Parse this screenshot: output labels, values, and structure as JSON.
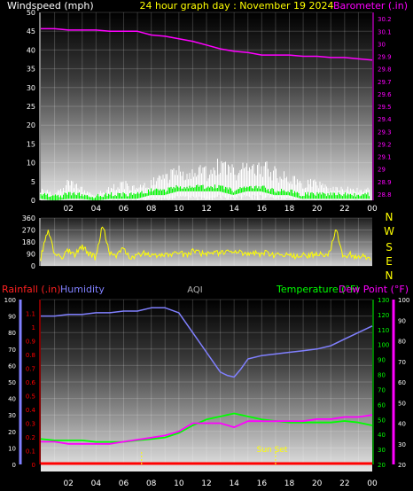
{
  "header": {
    "wind_label": "Windspeed (mph)",
    "graph_title": "24 hour graph day : November 19 2024",
    "baro_label": "Barometer (.in)"
  },
  "bottom_header": {
    "rain_label": "Rainfall (.in)",
    "humidity_label": "Humidity",
    "aqi_label": "AQI",
    "temp_label": "Temperature (°F)",
    "dew_label": "Dew Point (°F)"
  },
  "compass": [
    "N",
    "W",
    "S",
    "E",
    "N"
  ],
  "annotations": {
    "sunset": "Sun Set"
  },
  "colors": {
    "barometer": "#ff00ff",
    "wind": "#ffffff",
    "gust": "#00ff00",
    "direction": "#ffff00",
    "humidity": "#8080ff",
    "temperature": "#00ff00",
    "dewpoint": "#ff00ff",
    "rain": "#ff0000"
  },
  "chart_data": [
    {
      "type": "line",
      "title": "24 hour graph day : November 19 2024",
      "xlabel": "",
      "x_ticks": [
        "02",
        "04",
        "06",
        "08",
        "10",
        "12",
        "14",
        "16",
        "18",
        "20",
        "22",
        "00"
      ],
      "x_range": [
        0,
        24
      ],
      "y_left": {
        "label": "Windspeed (mph)",
        "range": [
          0,
          50
        ],
        "ticks": [
          0,
          5,
          10,
          15,
          20,
          25,
          30,
          35,
          40,
          45,
          50
        ]
      },
      "y_right": {
        "label": "Barometer (.in)",
        "range": [
          28.8,
          30.3
        ],
        "ticks": [
          28.8,
          28.9,
          29,
          29.1,
          29.2,
          29.3,
          29.4,
          29.5,
          29.6,
          29.7,
          29.8,
          29.9,
          30,
          30.1,
          30.2
        ]
      },
      "series": [
        {
          "name": "Barometer (.in)",
          "axis": "right",
          "x": [
            0,
            1,
            2,
            3,
            4,
            5,
            6,
            7,
            8,
            9,
            10,
            11,
            12,
            13,
            14,
            15,
            16,
            17,
            18,
            19,
            20,
            21,
            22,
            23,
            24
          ],
          "values": [
            30.12,
            30.12,
            30.11,
            30.11,
            30.11,
            30.1,
            30.1,
            30.1,
            30.07,
            30.06,
            30.04,
            30.02,
            29.99,
            29.96,
            29.94,
            29.93,
            29.91,
            29.91,
            29.91,
            29.9,
            29.9,
            29.89,
            29.89,
            29.88,
            29.87
          ]
        },
        {
          "name": "Windspeed (mph)",
          "axis": "left",
          "x": [
            0,
            1,
            2,
            3,
            4,
            5,
            6,
            7,
            8,
            9,
            10,
            11,
            12,
            13,
            14,
            15,
            16,
            17,
            18,
            19,
            20,
            21,
            22,
            23,
            24
          ],
          "values": [
            2,
            1,
            3,
            2,
            1,
            2,
            3,
            2,
            3,
            4,
            5,
            5,
            5,
            6,
            5,
            6,
            6,
            5,
            4,
            3,
            3,
            2,
            2,
            2,
            2
          ]
        },
        {
          "name": "Gust",
          "axis": "left",
          "x": [
            0,
            1,
            2,
            3,
            4,
            5,
            6,
            7,
            8,
            9,
            10,
            11,
            12,
            13,
            14,
            15,
            16,
            17,
            18,
            19,
            20,
            21,
            22,
            23,
            24
          ],
          "values": [
            1,
            0.5,
            1,
            1,
            0.5,
            1,
            1,
            1,
            2,
            2,
            3,
            3,
            3,
            3,
            2,
            3,
            3,
            2,
            2,
            1,
            1,
            1,
            1,
            1,
            1
          ]
        }
      ]
    },
    {
      "type": "line",
      "title": "",
      "x_ticks": [
        "02",
        "04",
        "06",
        "08",
        "10",
        "12",
        "14",
        "16",
        "18",
        "20",
        "22",
        "00"
      ],
      "x_range": [
        0,
        24
      ],
      "y_left": {
        "label": "",
        "range": [
          0,
          360
        ],
        "ticks": [
          0,
          90,
          180,
          270,
          360
        ]
      },
      "y_right": {
        "label": "",
        "categories": [
          "N",
          "W",
          "S",
          "E",
          "N"
        ]
      },
      "series": [
        {
          "name": "Wind direction",
          "axis": "left",
          "x": [
            0,
            0.5,
            1,
            1.5,
            2,
            2.5,
            3,
            3.5,
            4,
            4.5,
            5,
            5.5,
            6,
            6.5,
            7,
            7.5,
            8,
            8.5,
            9,
            9.5,
            10,
            10.5,
            11,
            11.5,
            12,
            12.5,
            13,
            13.5,
            14,
            14.5,
            15,
            15.5,
            16,
            16.5,
            17,
            17.5,
            18,
            18.5,
            19,
            19.5,
            20,
            20.5,
            21,
            21.5,
            22,
            22.5,
            23,
            23.5,
            24
          ],
          "values": [
            60,
            270,
            90,
            60,
            120,
            80,
            150,
            90,
            60,
            310,
            90,
            70,
            130,
            60,
            80,
            100,
            75,
            70,
            90,
            85,
            100,
            80,
            110,
            95,
            90,
            105,
            95,
            110,
            95,
            100,
            85,
            95,
            90,
            100,
            80,
            75,
            90,
            70,
            85,
            75,
            95,
            80,
            90,
            280,
            70,
            90,
            60,
            80,
            40
          ]
        }
      ]
    },
    {
      "type": "line",
      "title": "",
      "x_ticks": [
        "02",
        "04",
        "06",
        "08",
        "10",
        "12",
        "14",
        "16",
        "18",
        "20",
        "22",
        "00"
      ],
      "x_range": [
        0,
        24
      ],
      "y_axes": {
        "humidity": {
          "label": "Humidity",
          "range": [
            0,
            100
          ],
          "ticks": [
            0,
            10,
            20,
            30,
            40,
            50,
            60,
            70,
            80,
            90,
            100
          ]
        },
        "rainfall": {
          "label": "Rainfall (.in)",
          "range": [
            0,
            1.2
          ],
          "ticks": [
            0,
            0.1,
            0.2,
            0.3,
            0.4,
            0.5,
            0.6,
            0.7,
            0.8,
            0.9,
            1,
            1.1
          ]
        },
        "temperature": {
          "label": "Temperature (°F)",
          "range": [
            20,
            130
          ],
          "ticks": [
            20,
            30,
            40,
            50,
            60,
            70,
            80,
            90,
            100,
            110,
            120,
            130
          ]
        },
        "dew_point": {
          "label": "Dew Point (°F)",
          "range": [
            20,
            100
          ],
          "ticks": [
            20,
            30,
            40,
            50,
            60,
            70,
            80,
            90,
            100
          ]
        }
      },
      "series": [
        {
          "name": "Humidity",
          "axis": "humidity",
          "x": [
            0,
            1,
            2,
            3,
            4,
            5,
            6,
            7,
            8,
            9,
            10,
            11,
            12,
            12.5,
            13,
            13.5,
            14,
            14.5,
            15,
            16,
            17,
            18,
            19,
            20,
            21,
            22,
            23,
            24
          ],
          "values": [
            90,
            90,
            91,
            91,
            92,
            92,
            93,
            93,
            95,
            95,
            92,
            80,
            68,
            62,
            56,
            54,
            53,
            58,
            64,
            66,
            67,
            68,
            69,
            70,
            72,
            76,
            80,
            84
          ]
        },
        {
          "name": "Temperature (°F)",
          "axis": "temperature",
          "x": [
            0,
            1,
            2,
            3,
            4,
            5,
            6,
            7,
            8,
            9,
            10,
            11,
            12,
            13,
            14,
            15,
            16,
            17,
            18,
            19,
            20,
            21,
            22,
            23,
            24
          ],
          "values": [
            37,
            36,
            36,
            36,
            35,
            35,
            35,
            36,
            37,
            38,
            41,
            46,
            50,
            52,
            54,
            52,
            50,
            49,
            48,
            48,
            48,
            48,
            49,
            48,
            46
          ]
        },
        {
          "name": "Dew Point (°F)",
          "axis": "dew_point",
          "x": [
            0,
            1,
            2,
            3,
            4,
            5,
            6,
            7,
            8,
            9,
            10,
            11,
            12,
            13,
            14,
            15,
            16,
            17,
            18,
            19,
            20,
            21,
            22,
            23,
            24
          ],
          "values": [
            31,
            31,
            30,
            30,
            30,
            30,
            31,
            32,
            33,
            34,
            36,
            40,
            40,
            40,
            38,
            41,
            41,
            41,
            41,
            41,
            42,
            42,
            43,
            43,
            44
          ]
        },
        {
          "name": "Rainfall (.in)",
          "axis": "rainfall",
          "x": [
            0,
            24
          ],
          "values": [
            0,
            0
          ]
        }
      ],
      "markers": [
        {
          "x": 7.3,
          "label": ""
        },
        {
          "x": 17.0,
          "label": "Sun Set"
        }
      ]
    }
  ]
}
